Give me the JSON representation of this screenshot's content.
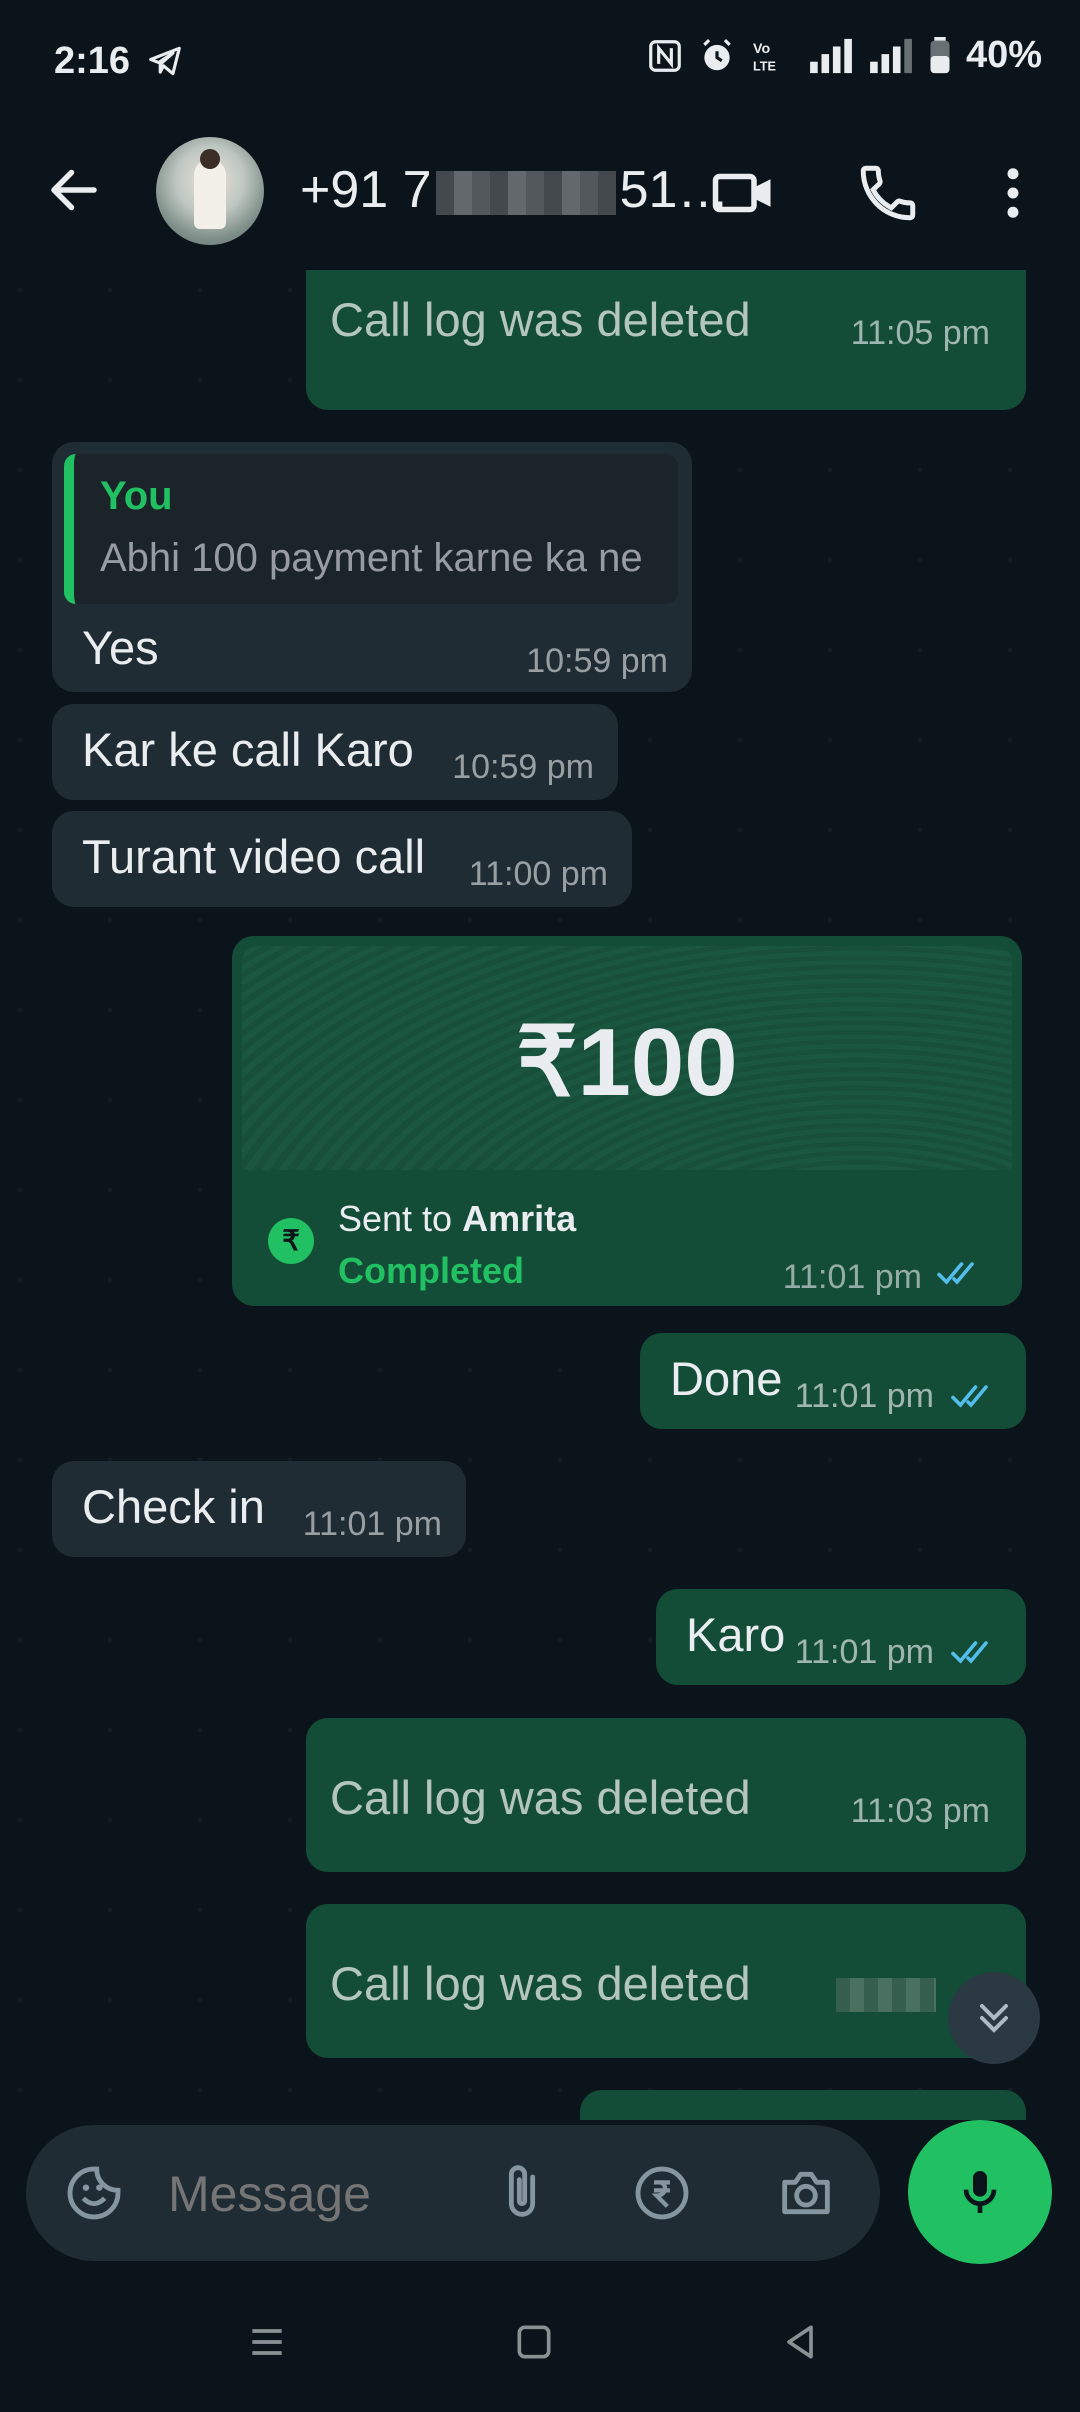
{
  "status_bar": {
    "time": "2:16",
    "battery": "40%"
  },
  "header": {
    "contact_name": "+91 7",
    "contact_name_tail": "51…"
  },
  "messages": [
    {
      "kind": "call-log",
      "text": "Call log was deleted",
      "time": "11:05 pm"
    },
    {
      "kind": "incoming-reply",
      "quote_author": "You",
      "quote_text": "Abhi 100 payment karne ka ne",
      "text": "Yes",
      "time": "10:59 pm"
    },
    {
      "kind": "incoming",
      "text": "Kar ke call Karo",
      "time": "10:59 pm"
    },
    {
      "kind": "incoming",
      "text": "Turant video call",
      "time": "11:00 pm"
    },
    {
      "kind": "payment",
      "amount": "₹100",
      "sent_to_label": "Sent to",
      "recipient": "Amrita",
      "status": "Completed",
      "time": "11:01 pm"
    },
    {
      "kind": "outgoing",
      "text": "Done",
      "time": "11:01 pm"
    },
    {
      "kind": "incoming",
      "text": "Check in",
      "time": "11:01 pm"
    },
    {
      "kind": "outgoing",
      "text": "Karo",
      "time": "11:01 pm"
    },
    {
      "kind": "call-log",
      "text": "Call log was deleted",
      "time": "11:03 pm"
    },
    {
      "kind": "call-log",
      "text": "Call log was deleted",
      "time": ""
    }
  ],
  "composer": {
    "placeholder": "Message"
  },
  "colors": {
    "accent": "#21c063",
    "outgoing_bubble": "#144d37",
    "incoming_bubble": "#202c33",
    "read_ticks": "#53bdeb"
  }
}
